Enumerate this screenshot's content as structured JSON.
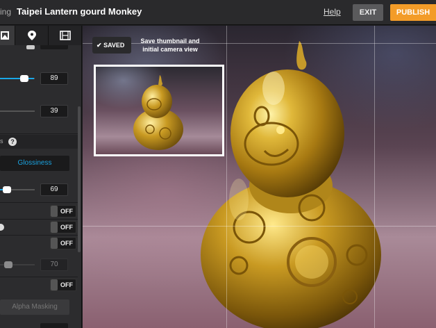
{
  "header": {
    "crumb_tail": "ing",
    "title": "Taipei Lantern gourd Monkey",
    "help_label": "Help",
    "exit_label": "EXIT",
    "publish_label": "PUBLISH",
    "publish_color": "#f39c28"
  },
  "tabs": [
    {
      "icon": "image-icon",
      "active": true
    },
    {
      "icon": "pin-icon",
      "active": false
    },
    {
      "icon": "film-icon",
      "active": false
    }
  ],
  "panel": {
    "slider1_value": "89",
    "slider1_level": 0.89,
    "slider2_value": "39",
    "slider2_level": 0.39,
    "section_tail": "s",
    "glossiness_label": "Glossiness",
    "slider3_value": "69",
    "slider3_level": 0.69,
    "toggle1": "OFF",
    "toggle2": "OFF",
    "toggle3": "OFF",
    "slider4_value": "70",
    "slider4_level": 0.7,
    "toggle4": "OFF",
    "alpha_masking_label": "Alpha Masking",
    "accent_color": "#19a8e8"
  },
  "viewport": {
    "saved_label": "SAVED",
    "saved_hint": "Save thumbnail and initial camera view"
  }
}
